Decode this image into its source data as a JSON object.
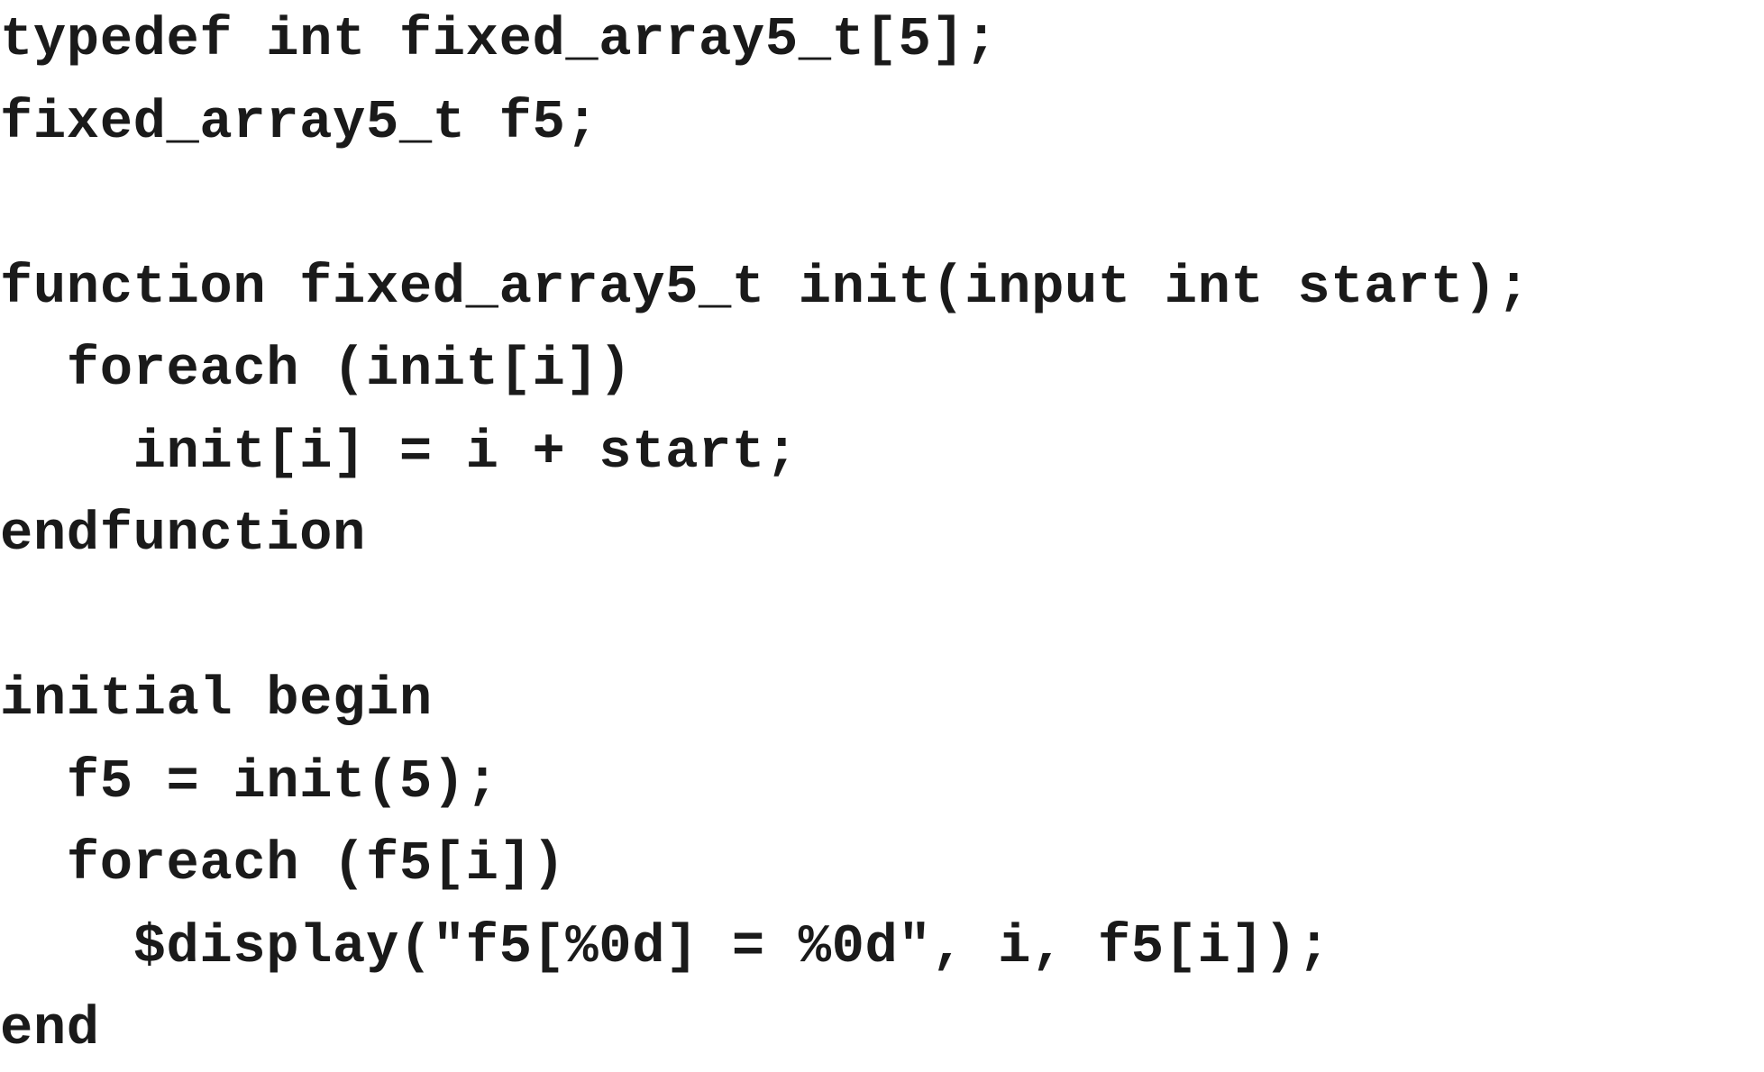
{
  "code": {
    "lines": [
      "typedef int fixed_array5_t[5];",
      "fixed_array5_t f5;",
      "",
      "function fixed_array5_t init(input int start);",
      "  foreach (init[i])",
      "    init[i] = i + start;",
      "endfunction",
      "",
      "initial begin",
      "  f5 = init(5);",
      "  foreach (f5[i])",
      "    $display(\"f5[%0d] = %0d\", i, f5[i]);",
      "end"
    ]
  }
}
